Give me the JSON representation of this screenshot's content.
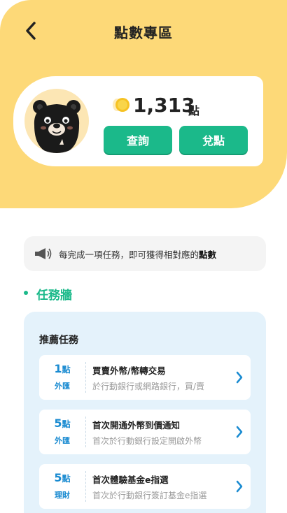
{
  "header": {
    "title": "點數專區",
    "back_icon": "chevron-left-icon"
  },
  "points": {
    "value": "1,313",
    "unit": "點",
    "coin_icon": "coin-icon",
    "query_label": "查詢",
    "redeem_label": "兌點"
  },
  "notice": {
    "icon": "megaphone-icon",
    "text_prefix": "每完成一項任務，即可獲得相對應的",
    "text_emphasis": "點數"
  },
  "section": {
    "title": "任務牆"
  },
  "tasks": {
    "panel_title": "推薦任務",
    "items": [
      {
        "points": "1",
        "unit": "點",
        "category": "外匯",
        "name": "買賣外幣/幣轉交易",
        "desc": "於行動銀行或網路銀行，買/賣"
      },
      {
        "points": "5",
        "unit": "點",
        "category": "外匯",
        "name": "首次開通外幣到價通知",
        "desc": "首次於行動銀行設定開啟外幣"
      },
      {
        "points": "5",
        "unit": "點",
        "category": "理財",
        "name": "首次體驗基金e指選",
        "desc": "首次於行動銀行簽訂基金e指選"
      }
    ]
  },
  "colors": {
    "header_bg": "#FDD978",
    "accent_green": "#1BB98A",
    "task_blue": "#1A8BD1",
    "panel_bg": "#E4F2FB"
  }
}
